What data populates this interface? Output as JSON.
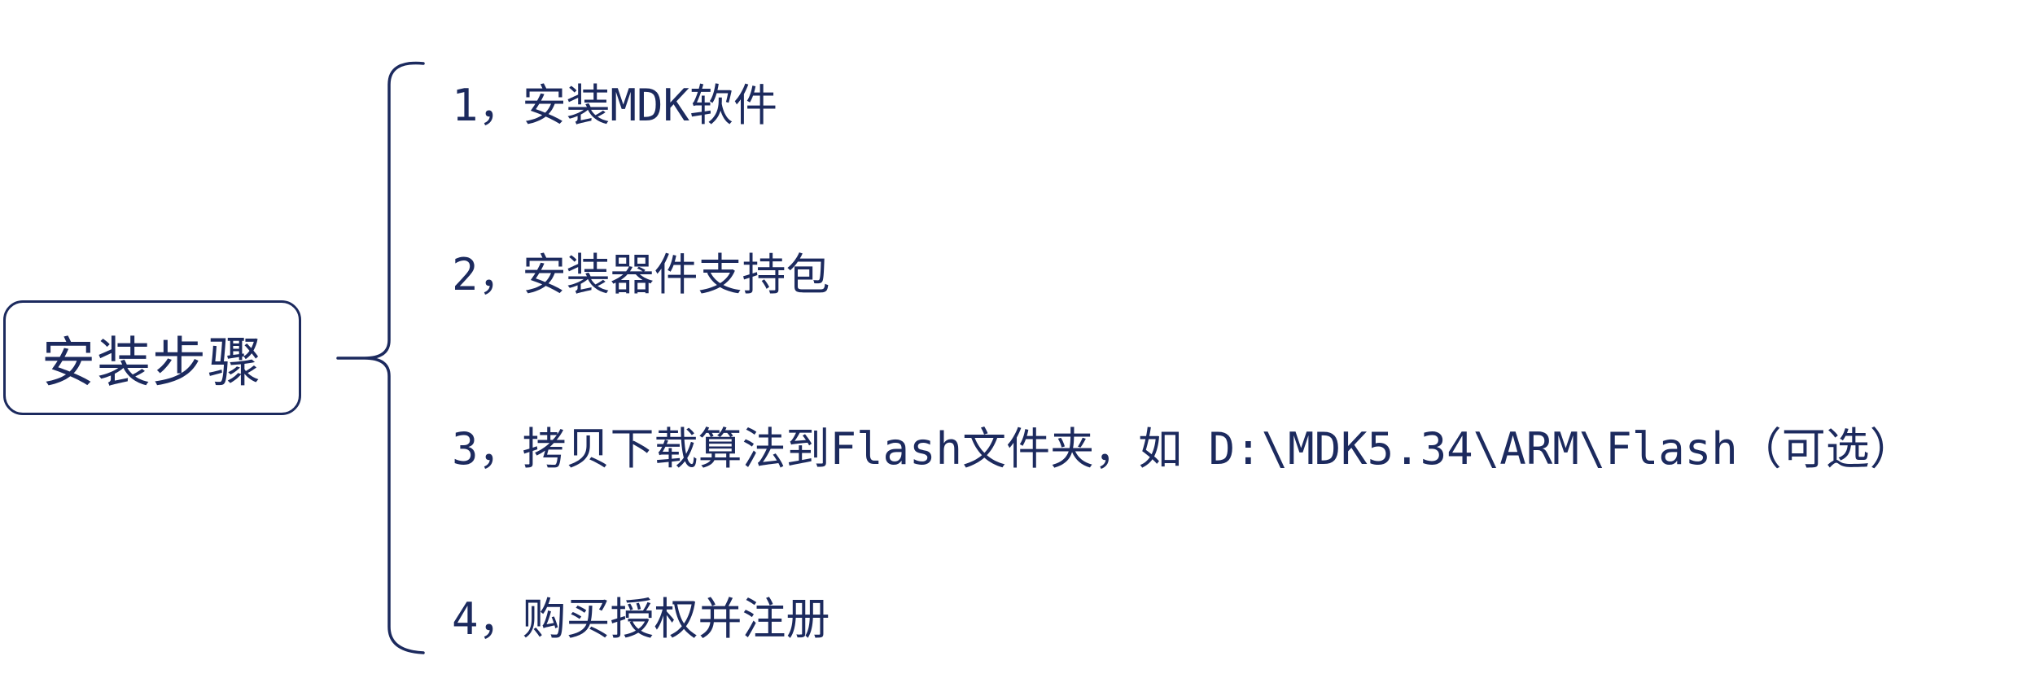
{
  "root": {
    "label": "安装步骤"
  },
  "steps": [
    {
      "text": "1，安装MDK软件"
    },
    {
      "text": "2，安装器件支持包"
    },
    {
      "text": "3，拷贝下载算法到Flash文件夹，如 D:\\MDK5.34\\ARM\\Flash（可选）"
    },
    {
      "text": "4，购买授权并注册"
    }
  ],
  "colors": {
    "stroke": "#1c2a5e",
    "text": "#1c2a5e",
    "background": "#ffffff"
  }
}
